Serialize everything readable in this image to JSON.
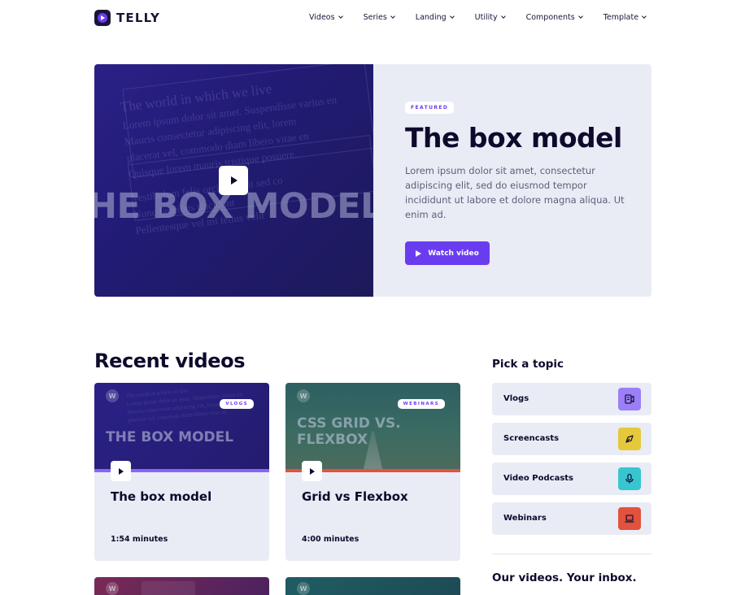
{
  "header": {
    "brand": "TELLY",
    "nav": [
      {
        "label": "Videos"
      },
      {
        "label": "Series"
      },
      {
        "label": "Landing"
      },
      {
        "label": "Utility"
      },
      {
        "label": "Components"
      },
      {
        "label": "Template"
      }
    ]
  },
  "hero": {
    "thumb_text": "HE BOX MODEL",
    "thumb_lines": [
      "The world in which we live",
      "Lorem ipsum dolor sit amet. Suspendisse varius en",
      "Mauris consectetur adipiscing elit, lorem",
      "placerat vel, commodo diam libero vitae en",
      "Quisque lorem mauris tristique posuere.",
      "Vestibulum felis orci, blandit sed co",
      "Nunc faucibus tincidunt",
      "Pellentesque vel mi tellus velit"
    ],
    "badge": "FEATURED",
    "title": "The box model",
    "description": "Lorem ipsum dolor sit amet, consectetur adipiscing elit, sed do eiusmod tempor incididunt ut labore et dolore magna aliqua. Ut enim ad.",
    "button_label": "Watch video",
    "colors": {
      "accent": "#6a3cf0",
      "panel": "#e9ecf5",
      "media": "#2a2187"
    }
  },
  "recent": {
    "title": "Recent videos",
    "cards": [
      {
        "title": "The box model",
        "category": "VLOGS",
        "duration": "1:54 minutes",
        "thumb_text": "THE BOX MODEL",
        "bar_color": "#8a63f5"
      },
      {
        "title": "Grid vs Flexbox",
        "category": "WEBINARS",
        "duration": "4:00 minutes",
        "thumb_text": "CSS GRID VS. FLEXBOX",
        "bar_color": "#e2523c"
      }
    ]
  },
  "sidebar": {
    "title": "Pick a topic",
    "topics": [
      {
        "label": "Vlogs",
        "icon": "video-file-icon",
        "color": "#9b7ff7"
      },
      {
        "label": "Screencasts",
        "icon": "cursor-icon",
        "color": "#e6c93a"
      },
      {
        "label": "Video Podcasts",
        "icon": "microphone-icon",
        "color": "#37c6cf"
      },
      {
        "label": "Webinars",
        "icon": "laptop-icon",
        "color": "#e2523c"
      }
    ],
    "newsletter_title": "Our videos. Your inbox."
  }
}
